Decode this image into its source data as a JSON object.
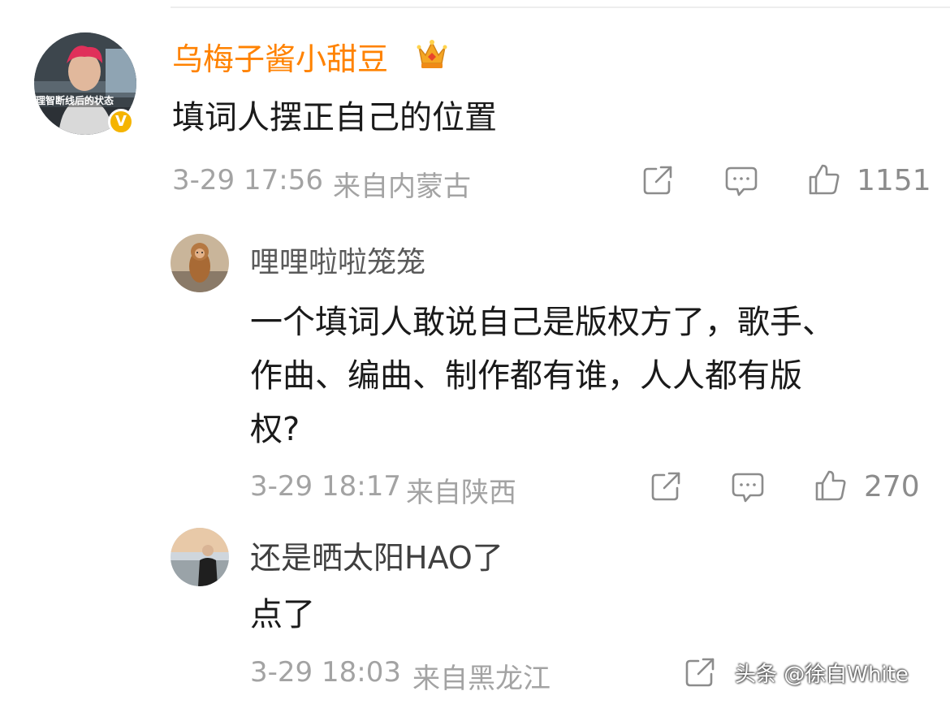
{
  "colors": {
    "vip_name": "#ff8200",
    "name": "#5a5a5a",
    "text": "#1a1a1a",
    "meta": "#a3a3a3",
    "verified_badge": "#f5b400"
  },
  "comments": [
    {
      "username": "乌梅子酱小甜豆",
      "avatar_caption": "理智断线后的状态",
      "badge_icon": "crown-icon",
      "verified": "V",
      "text_lines": [
        "填词人摆正自己的位置"
      ],
      "date": "3-29 17:56",
      "location": "来自内蒙古",
      "likes": "1151"
    },
    {
      "username": "哩哩啦啦笼笼",
      "text_lines": [
        "一个填词人敢说自己是版权方了，歌手、",
        "作曲、编曲、制作都有谁，人人都有版",
        "权?"
      ],
      "date": "3-29 18:17",
      "location": "来自陕西",
      "likes": "270"
    },
    {
      "username": "还是晒太阳HAO了",
      "text_lines": [
        "点了"
      ],
      "date": "3-29 18:03",
      "location": "来自黑龙江"
    }
  ],
  "watermark": "头条 @徐白White"
}
